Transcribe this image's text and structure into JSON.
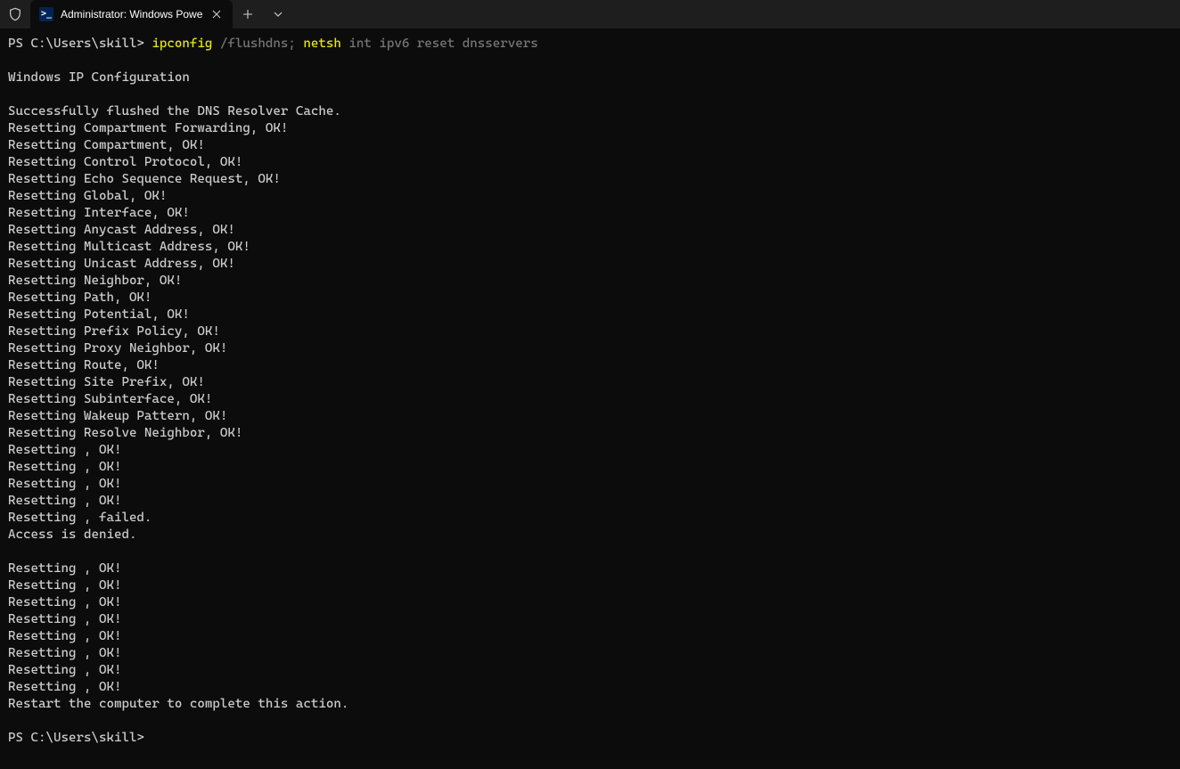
{
  "titlebar": {
    "tab_title": "Administrator: Windows Powe",
    "tab_icon_text": ">_"
  },
  "terminal": {
    "prompt1_prefix": "PS C:\\Users\\skill> ",
    "cmd_part1": "ipconfig",
    "cmd_part2": " /flushdns; ",
    "cmd_part3": "netsh",
    "cmd_part4": " int ipv6 reset dnsservers",
    "output_lines": [
      "",
      "Windows IP Configuration",
      "",
      "Successfully flushed the DNS Resolver Cache.",
      "Resetting Compartment Forwarding, OK!",
      "Resetting Compartment, OK!",
      "Resetting Control Protocol, OK!",
      "Resetting Echo Sequence Request, OK!",
      "Resetting Global, OK!",
      "Resetting Interface, OK!",
      "Resetting Anycast Address, OK!",
      "Resetting Multicast Address, OK!",
      "Resetting Unicast Address, OK!",
      "Resetting Neighbor, OK!",
      "Resetting Path, OK!",
      "Resetting Potential, OK!",
      "Resetting Prefix Policy, OK!",
      "Resetting Proxy Neighbor, OK!",
      "Resetting Route, OK!",
      "Resetting Site Prefix, OK!",
      "Resetting Subinterface, OK!",
      "Resetting Wakeup Pattern, OK!",
      "Resetting Resolve Neighbor, OK!",
      "Resetting , OK!",
      "Resetting , OK!",
      "Resetting , OK!",
      "Resetting , OK!",
      "Resetting , failed.",
      "Access is denied.",
      "",
      "Resetting , OK!",
      "Resetting , OK!",
      "Resetting , OK!",
      "Resetting , OK!",
      "Resetting , OK!",
      "Resetting , OK!",
      "Resetting , OK!",
      "Resetting , OK!",
      "Restart the computer to complete this action.",
      ""
    ],
    "prompt2": "PS C:\\Users\\skill>"
  }
}
